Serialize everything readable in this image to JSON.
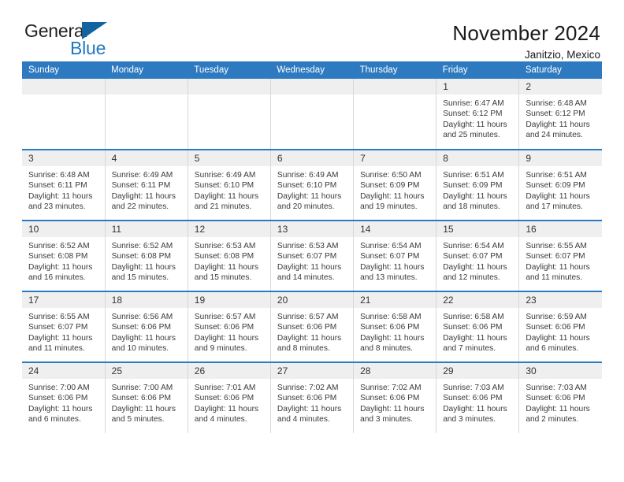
{
  "brand": {
    "name_part1": "General",
    "name_part2": "Blue",
    "flag_icon": "blue-triangle-flag-icon"
  },
  "header": {
    "title": "November 2024",
    "subtitle": "Janitzio, Mexico"
  },
  "calendar": {
    "weekday_headers": [
      "Sunday",
      "Monday",
      "Tuesday",
      "Wednesday",
      "Thursday",
      "Friday",
      "Saturday"
    ],
    "accent_color": "#2e7ac0",
    "daynum_bg": "#efefef",
    "weeks": [
      [
        {
          "day": "",
          "detail": ""
        },
        {
          "day": "",
          "detail": ""
        },
        {
          "day": "",
          "detail": ""
        },
        {
          "day": "",
          "detail": ""
        },
        {
          "day": "",
          "detail": ""
        },
        {
          "day": "1",
          "detail": "Sunrise: 6:47 AM\nSunset: 6:12 PM\nDaylight: 11 hours\nand 25 minutes."
        },
        {
          "day": "2",
          "detail": "Sunrise: 6:48 AM\nSunset: 6:12 PM\nDaylight: 11 hours\nand 24 minutes."
        }
      ],
      [
        {
          "day": "3",
          "detail": "Sunrise: 6:48 AM\nSunset: 6:11 PM\nDaylight: 11 hours\nand 23 minutes."
        },
        {
          "day": "4",
          "detail": "Sunrise: 6:49 AM\nSunset: 6:11 PM\nDaylight: 11 hours\nand 22 minutes."
        },
        {
          "day": "5",
          "detail": "Sunrise: 6:49 AM\nSunset: 6:10 PM\nDaylight: 11 hours\nand 21 minutes."
        },
        {
          "day": "6",
          "detail": "Sunrise: 6:49 AM\nSunset: 6:10 PM\nDaylight: 11 hours\nand 20 minutes."
        },
        {
          "day": "7",
          "detail": "Sunrise: 6:50 AM\nSunset: 6:09 PM\nDaylight: 11 hours\nand 19 minutes."
        },
        {
          "day": "8",
          "detail": "Sunrise: 6:51 AM\nSunset: 6:09 PM\nDaylight: 11 hours\nand 18 minutes."
        },
        {
          "day": "9",
          "detail": "Sunrise: 6:51 AM\nSunset: 6:09 PM\nDaylight: 11 hours\nand 17 minutes."
        }
      ],
      [
        {
          "day": "10",
          "detail": "Sunrise: 6:52 AM\nSunset: 6:08 PM\nDaylight: 11 hours\nand 16 minutes."
        },
        {
          "day": "11",
          "detail": "Sunrise: 6:52 AM\nSunset: 6:08 PM\nDaylight: 11 hours\nand 15 minutes."
        },
        {
          "day": "12",
          "detail": "Sunrise: 6:53 AM\nSunset: 6:08 PM\nDaylight: 11 hours\nand 15 minutes."
        },
        {
          "day": "13",
          "detail": "Sunrise: 6:53 AM\nSunset: 6:07 PM\nDaylight: 11 hours\nand 14 minutes."
        },
        {
          "day": "14",
          "detail": "Sunrise: 6:54 AM\nSunset: 6:07 PM\nDaylight: 11 hours\nand 13 minutes."
        },
        {
          "day": "15",
          "detail": "Sunrise: 6:54 AM\nSunset: 6:07 PM\nDaylight: 11 hours\nand 12 minutes."
        },
        {
          "day": "16",
          "detail": "Sunrise: 6:55 AM\nSunset: 6:07 PM\nDaylight: 11 hours\nand 11 minutes."
        }
      ],
      [
        {
          "day": "17",
          "detail": "Sunrise: 6:55 AM\nSunset: 6:07 PM\nDaylight: 11 hours\nand 11 minutes."
        },
        {
          "day": "18",
          "detail": "Sunrise: 6:56 AM\nSunset: 6:06 PM\nDaylight: 11 hours\nand 10 minutes."
        },
        {
          "day": "19",
          "detail": "Sunrise: 6:57 AM\nSunset: 6:06 PM\nDaylight: 11 hours\nand 9 minutes."
        },
        {
          "day": "20",
          "detail": "Sunrise: 6:57 AM\nSunset: 6:06 PM\nDaylight: 11 hours\nand 8 minutes."
        },
        {
          "day": "21",
          "detail": "Sunrise: 6:58 AM\nSunset: 6:06 PM\nDaylight: 11 hours\nand 8 minutes."
        },
        {
          "day": "22",
          "detail": "Sunrise: 6:58 AM\nSunset: 6:06 PM\nDaylight: 11 hours\nand 7 minutes."
        },
        {
          "day": "23",
          "detail": "Sunrise: 6:59 AM\nSunset: 6:06 PM\nDaylight: 11 hours\nand 6 minutes."
        }
      ],
      [
        {
          "day": "24",
          "detail": "Sunrise: 7:00 AM\nSunset: 6:06 PM\nDaylight: 11 hours\nand 6 minutes."
        },
        {
          "day": "25",
          "detail": "Sunrise: 7:00 AM\nSunset: 6:06 PM\nDaylight: 11 hours\nand 5 minutes."
        },
        {
          "day": "26",
          "detail": "Sunrise: 7:01 AM\nSunset: 6:06 PM\nDaylight: 11 hours\nand 4 minutes."
        },
        {
          "day": "27",
          "detail": "Sunrise: 7:02 AM\nSunset: 6:06 PM\nDaylight: 11 hours\nand 4 minutes."
        },
        {
          "day": "28",
          "detail": "Sunrise: 7:02 AM\nSunset: 6:06 PM\nDaylight: 11 hours\nand 3 minutes."
        },
        {
          "day": "29",
          "detail": "Sunrise: 7:03 AM\nSunset: 6:06 PM\nDaylight: 11 hours\nand 3 minutes."
        },
        {
          "day": "30",
          "detail": "Sunrise: 7:03 AM\nSunset: 6:06 PM\nDaylight: 11 hours\nand 2 minutes."
        }
      ]
    ]
  }
}
